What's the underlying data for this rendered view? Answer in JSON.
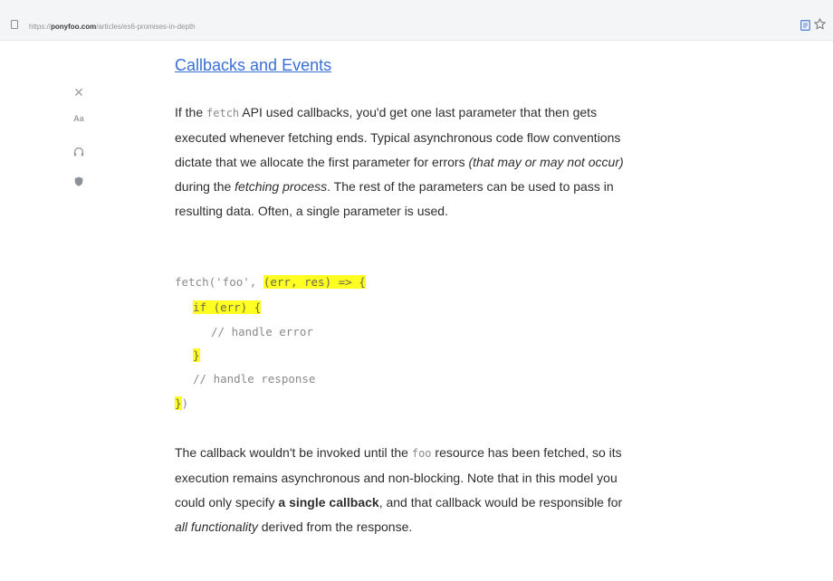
{
  "browser": {
    "url_prefix": "https://",
    "url_host": "ponyfoo.com",
    "url_path": "/articles/es6-promises-in-depth"
  },
  "article": {
    "heading": "Callbacks and Events",
    "p1": {
      "a": "If the ",
      "code_fetch": "fetch",
      "b": " API used callbacks, you'd get one last parameter that then gets executed whenever fetching ends. Typical asynchronous code flow conventions dictate that we allocate the first parameter for errors ",
      "em1": "(that may or may not occur)",
      "c": " during the ",
      "em2": "fetching process",
      "d": ". The rest of the parameters can be used to pass in resulting data. Often, a single parameter is used."
    },
    "code": {
      "l1_plain": "fetch('foo', ",
      "l1_hl": "(err, res) => {",
      "l2_hl": "if (err) {",
      "l3_plain": "// handle error",
      "l4_hl": "}",
      "l5_plain": "// handle response",
      "l6_hl": "}",
      "l6_plain": ")"
    },
    "p2": {
      "a": "The callback wouldn't be invoked until the ",
      "code_foo": "foo",
      "b": " resource has been fetched, so its execution remains asynchronous and non-blocking. Note that in this model you could only specify ",
      "strong": "a single callback",
      "c": ", and that callback would be responsible for ",
      "em": "all functionality",
      "d": " derived from the response."
    }
  },
  "tools": {
    "font_label": "Aa"
  },
  "icons": [
    "page-icon",
    "reader-view-icon",
    "bookmark-star-icon",
    "close-icon",
    "font-icon",
    "headphones-icon",
    "shield-icon"
  ]
}
